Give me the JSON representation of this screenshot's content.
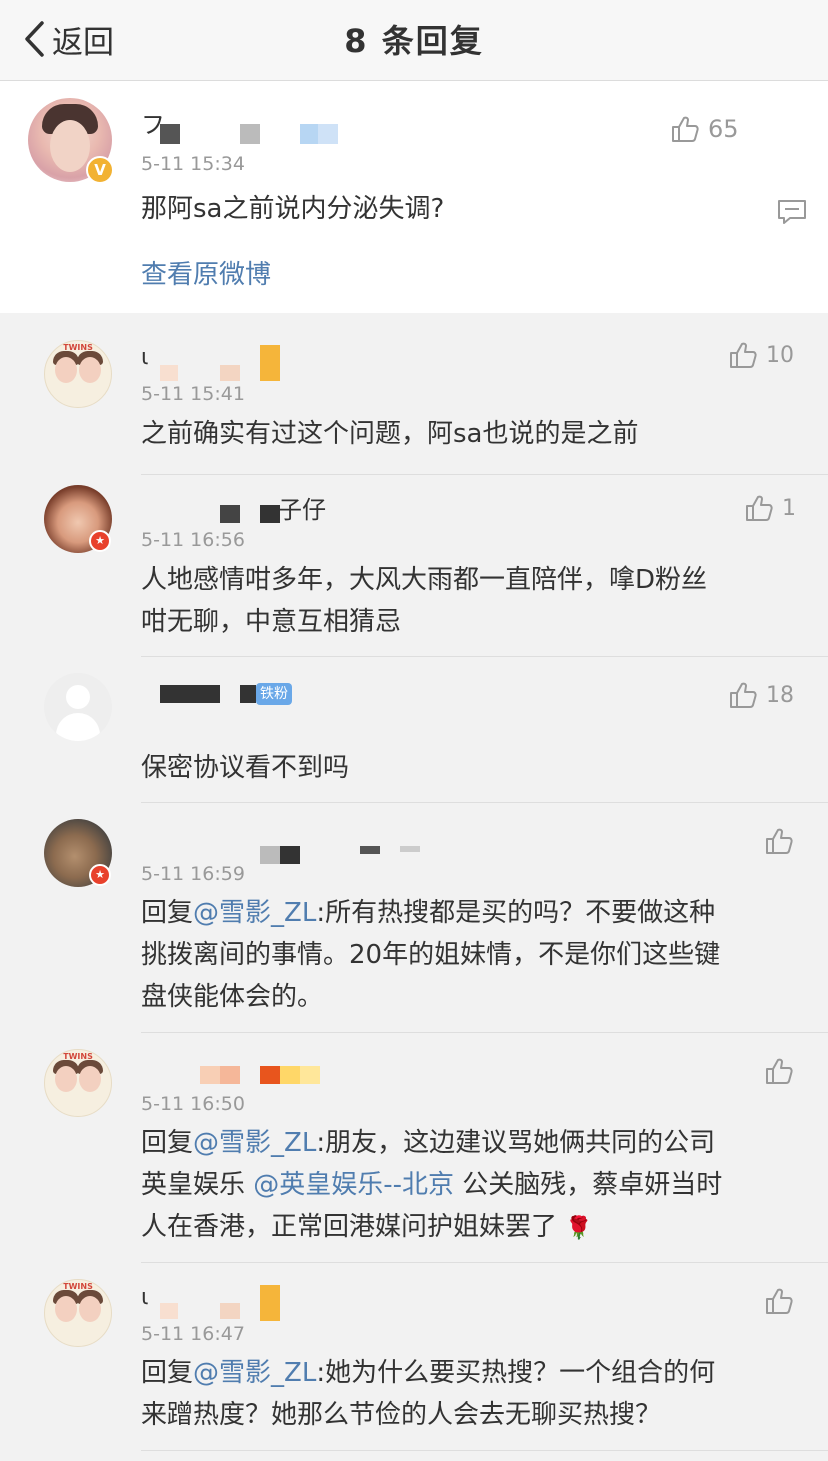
{
  "nav": {
    "back_label": "返回",
    "title": "8 条回复"
  },
  "main_post": {
    "username_prefix": "フ",
    "time": "5-11 15:34",
    "likes": "65",
    "content": "那阿sa之前说内分泌失调?",
    "view_original": "查看原微博",
    "verified_badge": "V"
  },
  "comments": [
    {
      "name_prefix": "ι",
      "time": "5-11 15:41",
      "likes": "10",
      "content": "之前确实有过这个问题，阿sa也说的是之前"
    },
    {
      "name_suffix": "子仔",
      "time": "5-11 16:56",
      "likes": "1",
      "content_line1": "人地感情咁多年，大风大雨都一直陪伴，嗱D粉丝",
      "content_line2": "咁无聊，中意互相猜忌"
    },
    {
      "badge": "铁粉",
      "likes": "18",
      "content": "保密协议看不到吗"
    },
    {
      "time": "5-11 16:59",
      "prefix": "回复",
      "mention": "@雪影_ZL",
      "content_line1": ":所有热搜都是买的吗？不要做这种",
      "content_line2": "挑拨离间的事情。20年的姐妹情，不是你们这些键",
      "content_line3": "盘侠能体会的。"
    },
    {
      "time": "5-11 16:50",
      "prefix": "回复",
      "mention": "@雪影_ZL",
      "content_line1": ":朋友，这边建议骂她俩共同的公司",
      "line2_a": "英皇娱乐 ",
      "line2_mention": "@英皇娱乐--北京",
      "line2_b": " 公关脑残，蔡卓妍当时",
      "content_line3": "人在香港，正常回港媒问护姐妹罢了 ",
      "emoji": "🌹"
    },
    {
      "name_prefix": "ι",
      "time": "5-11 16:47",
      "prefix": "回复",
      "mention": "@雪影_ZL",
      "content_line1": ":她为什么要买热搜？一个组合的何",
      "content_line2": "来蹭热度？她那么节俭的人会去无聊买热搜？"
    }
  ],
  "avatar_twins_label": "TWINS",
  "colors": {
    "link": "#507daf",
    "meta": "#999999",
    "background": "#f2f2f2"
  }
}
